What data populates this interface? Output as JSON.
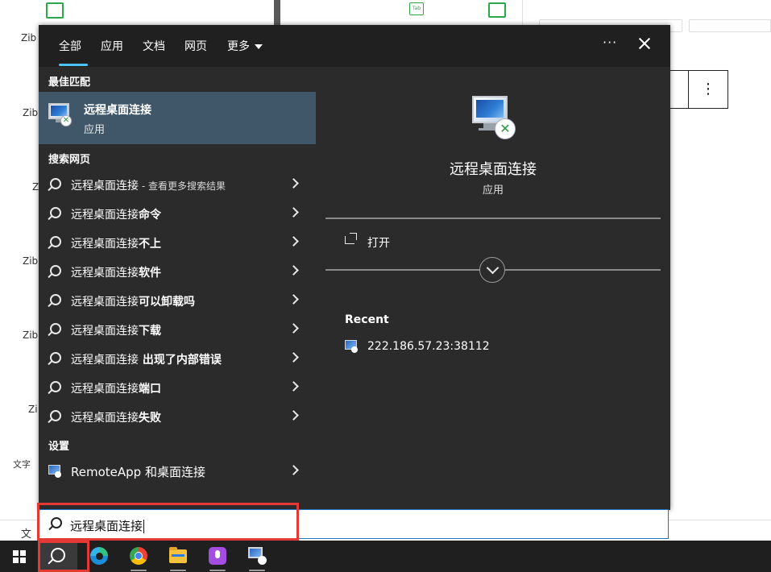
{
  "background_app": {
    "left_labels": [
      "Zib",
      "Zib",
      "Z",
      "Zib",
      "Zib",
      "Zi"
    ],
    "text_label": "文字",
    "bottom_label": "文",
    "icon_caption": "Tab",
    "vertical_dots": "⋮"
  },
  "search_panel": {
    "tabs": [
      {
        "label": "全部",
        "active": true
      },
      {
        "label": "应用"
      },
      {
        "label": "文档"
      },
      {
        "label": "网页"
      },
      {
        "label": "更多"
      }
    ],
    "more_options": "···",
    "best_match": {
      "section_title": "最佳匹配",
      "app_name": "远程桌面连接",
      "app_type": "应用"
    },
    "web_section_title": "搜索网页",
    "web_results": [
      {
        "prefix": "远程桌面连接",
        "bold": "",
        "suffix": " - 查看更多搜索结果"
      },
      {
        "prefix": "远程桌面连接",
        "bold": "命令",
        "suffix": ""
      },
      {
        "prefix": "远程桌面连接",
        "bold": "不上",
        "suffix": ""
      },
      {
        "prefix": "远程桌面连接",
        "bold": "软件",
        "suffix": ""
      },
      {
        "prefix": "远程桌面连接",
        "bold": "可以卸载吗",
        "suffix": ""
      },
      {
        "prefix": "远程桌面连接",
        "bold": "下载",
        "suffix": ""
      },
      {
        "prefix": "远程桌面连接",
        "bold": " 出现了内部错误",
        "suffix": ""
      },
      {
        "prefix": "远程桌面连接",
        "bold": "端口",
        "suffix": ""
      },
      {
        "prefix": "远程桌面连接",
        "bold": "失败",
        "suffix": ""
      }
    ],
    "settings": {
      "section_title": "设置",
      "item_label": "RemoteApp 和桌面连接"
    },
    "detail": {
      "app_name": "远程桌面连接",
      "app_type": "应用",
      "open_label": "打开",
      "recent_title": "Recent",
      "recent_items": [
        "222.186.57.23:38112"
      ]
    },
    "query": "远程桌面连接"
  },
  "taskbar": {
    "items": [
      "start",
      "search",
      "edge",
      "chrome",
      "file-explorer",
      "voice-recorder",
      "remote-desktop"
    ]
  },
  "colors": {
    "panel_bg": "#2b2b2b",
    "selected_bg": "#3f5769",
    "accent": "#4cc2ff",
    "annotation": "#e53935"
  }
}
